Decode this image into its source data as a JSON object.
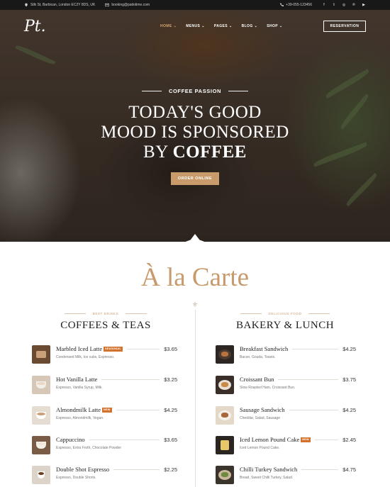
{
  "topbar": {
    "address": "Silk St, Barbican, London EC2Y 8DS, UK",
    "email": "booking@patiotime.com",
    "phone": "+39-055-123456",
    "social": [
      "facebook-icon",
      "twitter-icon",
      "instagram-icon",
      "pinterest-icon",
      "youtube-icon"
    ]
  },
  "nav": {
    "logo": "Pt.",
    "menu": [
      {
        "label": "HOME",
        "active": true
      },
      {
        "label": "MENUS",
        "active": false
      },
      {
        "label": "PAGES",
        "active": false
      },
      {
        "label": "BLOG",
        "active": false
      },
      {
        "label": "SHOP",
        "active": false
      }
    ],
    "reservation": "RESERVATION"
  },
  "hero": {
    "kicker": "COFFEE PASSION",
    "line1": "TODAY'S GOOD",
    "line2": "MOOD IS SPONSORED",
    "line3_pre": "BY ",
    "line3_bold": "COFFEE",
    "button": "ORDER ONLINE"
  },
  "carte": {
    "title": "À la Carte",
    "left": {
      "sub": "BEST DRINKS",
      "heading": "COFFEES & TEAS",
      "items": [
        {
          "name": "Marbled Iced Latte",
          "badge": "SEASONAL",
          "price": "$3.65",
          "desc": "Condensed Milk, Ice cubs, Espresso."
        },
        {
          "name": "Hot Vanilla Latte",
          "badge": "",
          "price": "$3.25",
          "desc": "Espresso, Vanilla Syrup, Milk."
        },
        {
          "name": "Almondmilk Latte",
          "badge": "NEW",
          "price": "$4.25",
          "desc": "Espresso, Almondmilk, Vegan."
        },
        {
          "name": "Cappuccino",
          "badge": "",
          "price": "$3.65",
          "desc": "Espresso, Extra Froth, Chocolate Powder"
        },
        {
          "name": "Double Shot Espresso",
          "badge": "",
          "price": "$2.25",
          "desc": "Espresso, Double Shorts."
        }
      ]
    },
    "right": {
      "sub": "DELICIOUS FOOD",
      "heading": "BAKERY & LUNCH",
      "items": [
        {
          "name": "Breakfast Sandwich",
          "badge": "",
          "price": "$4.25",
          "desc": "Bacon, Gouda, Toasts."
        },
        {
          "name": "Croissant Bun",
          "badge": "",
          "price": "$3.75",
          "desc": "Slow Roasted Ham, Croissant Bun."
        },
        {
          "name": "Sausage Sandwich",
          "badge": "",
          "price": "$4.25",
          "desc": "Cheddar, Salad, Sausage"
        },
        {
          "name": "Iced Lemon Pound Cake",
          "badge": "NEW",
          "price": "$2.45",
          "desc": "Iced Lemon Pound Cake."
        },
        {
          "name": "Chilli Turkey Sandwich",
          "badge": "",
          "price": "$4.75",
          "desc": "Bread, Sweet Chilli Turkey, Salad."
        }
      ]
    }
  },
  "colors": {
    "accent": "#c8996a",
    "badge": "#d2722d",
    "topbar": "#181818"
  }
}
